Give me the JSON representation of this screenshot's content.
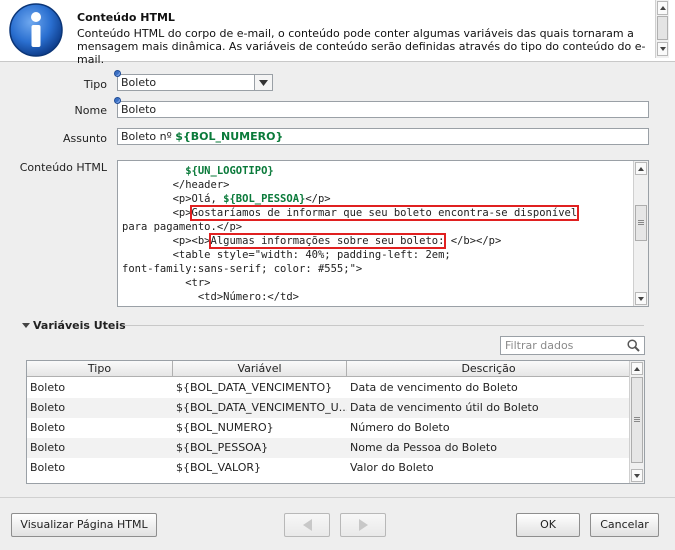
{
  "header": {
    "title": "Conteúdo HTML",
    "description": "Conteúdo HTML do corpo de e-mail, o conteúdo pode conter algumas variáveis das quais tornaram a mensagem mais dinâmica. As variáveis de conteúdo serão definidas através do tipo do conteúdo do e-mail."
  },
  "form": {
    "tipo_label": "Tipo",
    "tipo_value": "Boleto",
    "nome_label": "Nome",
    "nome_value": "Boleto",
    "assunto_label": "Assunto",
    "assunto_prefix": "Boleto nº ",
    "assunto_var": "${BOL_NUMERO}",
    "conteudo_label": "Conteúdo HTML"
  },
  "code": {
    "l1_var": "${UN_LOGOTIPO}",
    "l2": "</header>",
    "l3_a": "<p>Olá, ",
    "l3_var": "${BOL_PESSOA}",
    "l3_b": "</p>",
    "l4_a": "<p>",
    "l4_hl": "Gostaríamos de informar que seu boleto encontra-se disponível",
    "l5": "para pagamento.</p>",
    "l6_a": "<p><b>",
    "l6_hl": "Algumas informações sobre seu boleto:",
    "l6_b": " </b></p>",
    "l7": "<table style=\"width: 40%; padding-left: 2em;",
    "l8": "font-family:sans-serif; color: #555;\">",
    "l9": "<tr>",
    "l10": "<td>Número:</td>"
  },
  "variables": {
    "section_title": "Variáveis Uteis",
    "filter_placeholder": "Filtrar dados",
    "columns": [
      "Tipo",
      "Variável",
      "Descrição"
    ],
    "rows": [
      {
        "tipo": "Boleto",
        "variavel": "${BOL_DATA_VENCIMENTO}",
        "descricao": "Data de vencimento do Boleto"
      },
      {
        "tipo": "Boleto",
        "variavel": "${BOL_DATA_VENCIMENTO_U...",
        "descricao": "Data de vencimento útil do Boleto"
      },
      {
        "tipo": "Boleto",
        "variavel": "${BOL_NUMERO}",
        "descricao": "Número do Boleto"
      },
      {
        "tipo": "Boleto",
        "variavel": "${BOL_PESSOA}",
        "descricao": "Nome da Pessoa do Boleto"
      },
      {
        "tipo": "Boleto",
        "variavel": "${BOL_VALOR}",
        "descricao": "Valor do Boleto"
      }
    ]
  },
  "buttons": {
    "preview": "Visualizar Página HTML",
    "ok": "OK",
    "cancel": "Cancelar"
  },
  "icons": {
    "info": "info-icon",
    "search": "search-icon",
    "prev": "arrow-left-icon",
    "next": "arrow-right-icon",
    "dropdown": "chevron-down-icon"
  },
  "colors": {
    "variable": "#0a7a3a",
    "highlight": "#e02020",
    "info_icon": "#1a5fb4"
  }
}
